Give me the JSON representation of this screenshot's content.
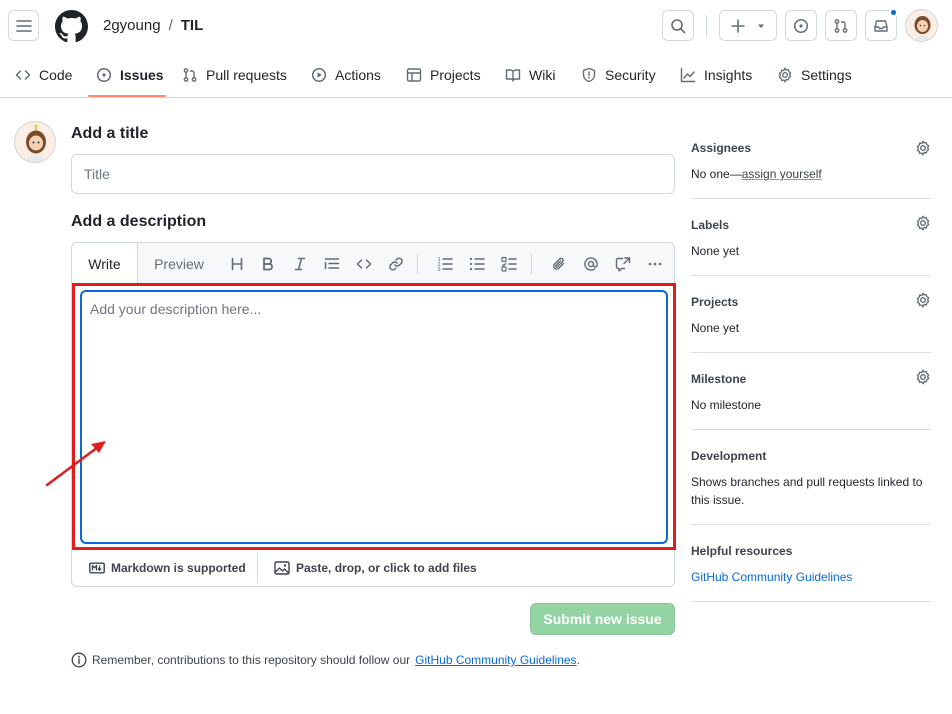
{
  "header": {
    "owner": "2gyoung",
    "separator": "/",
    "repo": "TIL"
  },
  "tabs": [
    {
      "label": "Code",
      "icon": "code-icon"
    },
    {
      "label": "Issues",
      "icon": "issue-icon"
    },
    {
      "label": "Pull requests",
      "icon": "pull-request-icon"
    },
    {
      "label": "Actions",
      "icon": "play-icon"
    },
    {
      "label": "Projects",
      "icon": "table-icon"
    },
    {
      "label": "Wiki",
      "icon": "book-icon"
    },
    {
      "label": "Security",
      "icon": "shield-icon"
    },
    {
      "label": "Insights",
      "icon": "graph-icon"
    },
    {
      "label": "Settings",
      "icon": "gear-icon"
    }
  ],
  "active_tab": "Issues",
  "form": {
    "title_heading": "Add a title",
    "title_placeholder": "Title",
    "description_heading": "Add a description",
    "write_tab": "Write",
    "preview_tab": "Preview",
    "description_placeholder": "Add your description here...",
    "markdown_note": "Markdown is supported",
    "attach_note": "Paste, drop, or click to add files",
    "submit_label": "Submit new issue",
    "remember_text": "Remember, contributions to this repository should follow our",
    "remember_link": "GitHub Community Guidelines",
    "remember_end": "."
  },
  "sidebar": {
    "assignees": {
      "heading": "Assignees",
      "value": "No one—",
      "link": "assign yourself"
    },
    "labels": {
      "heading": "Labels",
      "value": "None yet"
    },
    "projects": {
      "heading": "Projects",
      "value": "None yet"
    },
    "milestone": {
      "heading": "Milestone",
      "value": "No milestone"
    },
    "development": {
      "heading": "Development",
      "value": "Shows branches and pull requests linked to this issue."
    },
    "helpful": {
      "heading": "Helpful resources",
      "link": "GitHub Community Guidelines"
    }
  },
  "colors": {
    "accent": "#0969da",
    "active_tab_underline": "#fd8c73",
    "submit_disabled": "#94d3a2",
    "annotation_red": "#e01c1c",
    "notification_dot": "#0969da"
  }
}
